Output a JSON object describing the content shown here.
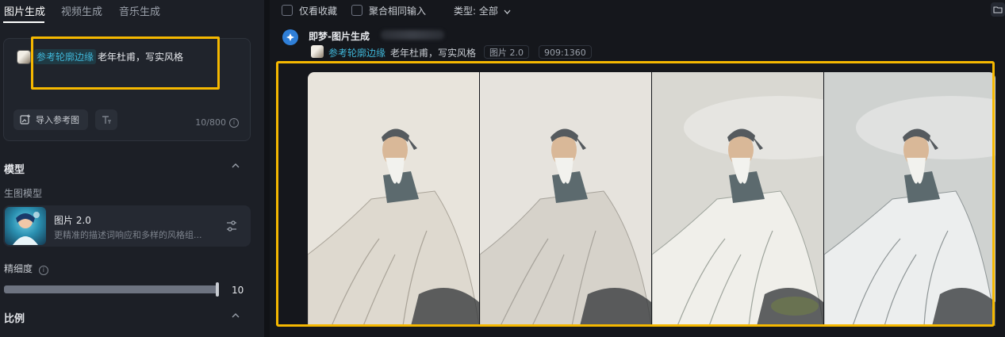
{
  "left_panel": {
    "tabs": [
      {
        "label": "图片生成",
        "active": true
      },
      {
        "label": "视频生成",
        "active": false
      },
      {
        "label": "音乐生成",
        "active": false
      }
    ],
    "prompt": {
      "reference_tag": "参考轮廓边缘",
      "text": "老年杜甫，写实风格",
      "import_button": "导入参考图",
      "t_button_icon": "text-format-icon",
      "char_count": "10/800"
    },
    "model_section": {
      "title": "模型",
      "sub_label": "生图模型",
      "model_name": "图片 2.0",
      "model_desc": "更精准的描述词响应和多样的风格组..."
    },
    "detail": {
      "label": "精细度",
      "value": "10",
      "fill_fraction": 1.0
    },
    "ratio_section": {
      "title": "比例"
    }
  },
  "right_panel": {
    "filters": {
      "favorites_only": "仅看收藏",
      "merge_same": "聚合相同输入",
      "type_label": "类型: 全部"
    },
    "generation": {
      "title": "即梦-图片生成",
      "reference_tag": "参考轮廓边缘",
      "prompt_text": "老年杜甫，写实风格",
      "model_chip": "图片 2.0",
      "ratio_chip": "909:1360"
    },
    "images": [
      {
        "alt": "portrait-1",
        "background": "#e8e4dc"
      },
      {
        "alt": "portrait-2",
        "background": "#e6e3dd"
      },
      {
        "alt": "portrait-3",
        "background": "#d9d8d2"
      },
      {
        "alt": "portrait-4",
        "background": "#cfd2d0"
      }
    ]
  },
  "colors": {
    "highlight": "#f5b800",
    "accent": "#3fb6d8",
    "panel": "#1c1f26",
    "background": "#15171c"
  }
}
